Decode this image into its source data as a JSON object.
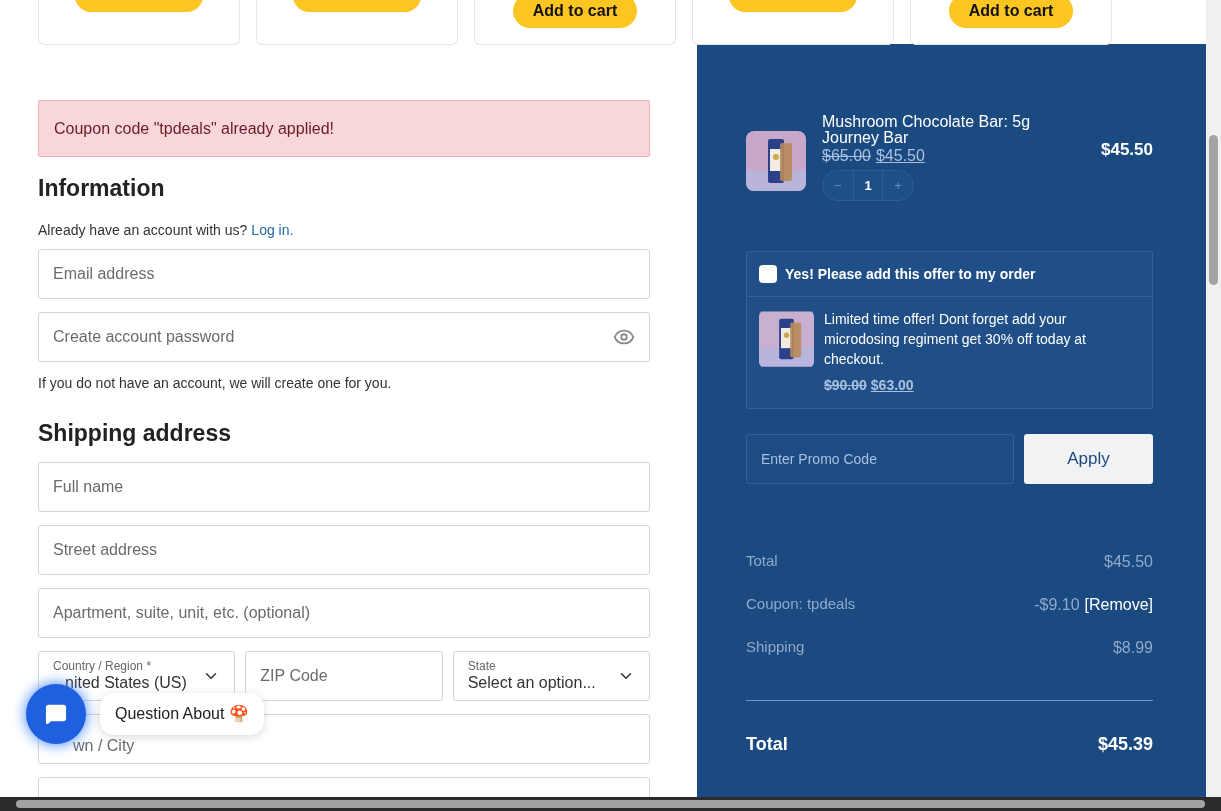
{
  "product_cards": [
    {
      "kind": "clipped"
    },
    {
      "kind": "clipped"
    },
    {
      "kind": "labeled",
      "button": "Add to cart"
    },
    {
      "kind": "clipped"
    },
    {
      "kind": "labeled",
      "button": "Add to cart"
    }
  ],
  "notice": "Coupon code \"tpdeals\" already applied!",
  "information": {
    "heading": "Information",
    "prompt": "Already have an account with us?",
    "login_link": "Log in.",
    "fields": [
      {
        "kind": "text",
        "placeholder": "Email address"
      },
      {
        "kind": "password",
        "placeholder": "Create account password"
      }
    ],
    "note": "If you do not have an account, we will create one for you."
  },
  "shipping": {
    "heading": "Shipping address",
    "fields": [
      {
        "kind": "text",
        "placeholder": "Full name"
      },
      {
        "kind": "text",
        "placeholder": "Street address"
      },
      {
        "kind": "text",
        "placeholder": "Apartment, suite, unit, etc. (optional)"
      }
    ],
    "address_row": [
      {
        "kind": "select",
        "label": "Country / Region *",
        "value": "nited States (US)"
      },
      {
        "kind": "text",
        "placeholder": "ZIP Code"
      },
      {
        "kind": "select",
        "label": "State",
        "value": "Select an option..."
      }
    ],
    "more_fields": [
      {
        "kind": "text",
        "placeholder": "wn / City"
      },
      {
        "kind": "text"
      }
    ]
  },
  "chat": {
    "bubble": "Question About 🍄"
  },
  "order": {
    "item": {
      "title": "Mushroom Chocolate Bar: 5g Journey Bar",
      "old_price": "$65.00",
      "price": "$45.50",
      "quantity": "1",
      "minus": "−",
      "plus": "+",
      "line_total": "$45.50"
    },
    "offer": {
      "checkbox_label": "Yes! Please add this offer to my order",
      "checked": false,
      "text": "Limited time offer! Dont forget add your microdosing regiment get 30% off today at checkout.",
      "old_price": "$90.00",
      "price": "$63.00"
    },
    "promo": {
      "placeholder": "Enter Promo Code",
      "button": "Apply"
    },
    "rows": [
      {
        "label": "Total",
        "value": "$45.50"
      },
      {
        "label": "Coupon: tpdeals",
        "value": "-$9.10",
        "action": "[Remove]"
      },
      {
        "label": "Shipping",
        "value": "$8.99"
      }
    ],
    "grand_total": {
      "label": "Total",
      "value": "$45.39"
    }
  }
}
